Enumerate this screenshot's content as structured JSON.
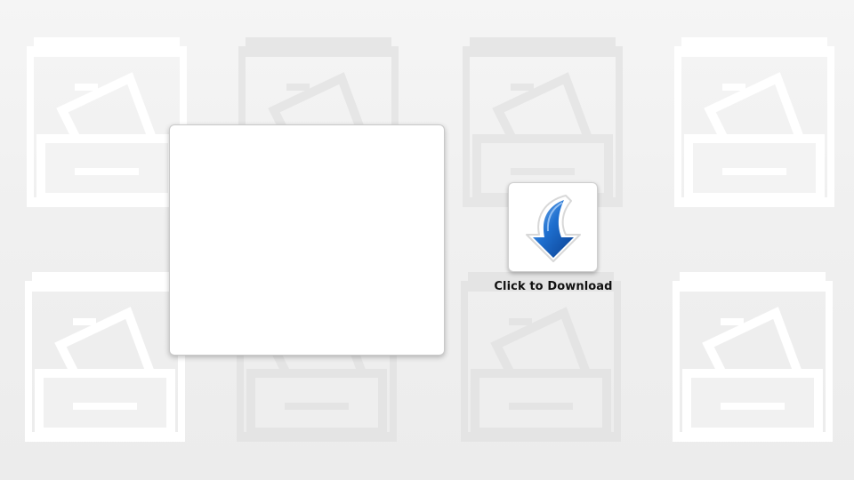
{
  "background": {
    "color": "#f2f2f2",
    "pattern_icon": "filing-cabinet-drawer-icon",
    "pattern_color": "#ffffff"
  },
  "preview_panel": {
    "background": "#ffffff"
  },
  "download": {
    "label": "Click to Download",
    "icon": "download-arrow-icon",
    "arrow_color": "#1565c0"
  }
}
